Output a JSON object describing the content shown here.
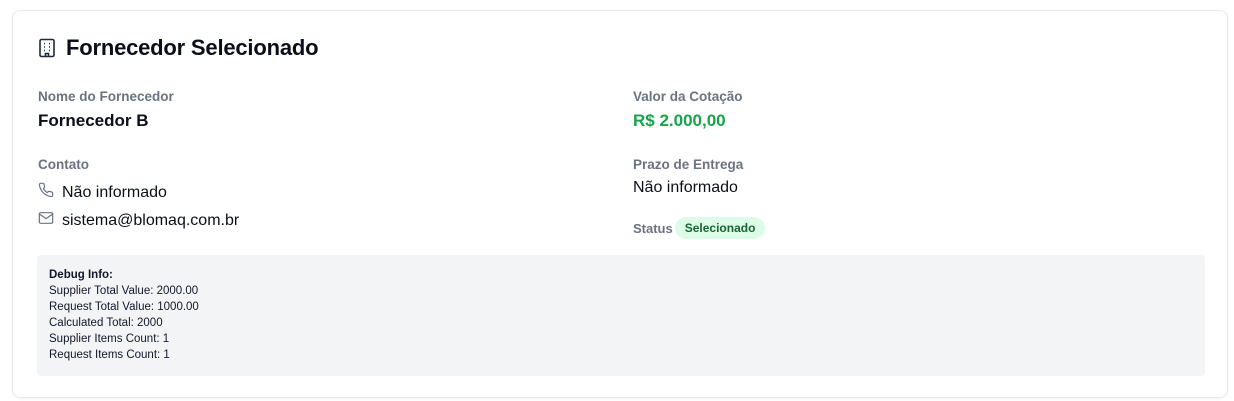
{
  "header": {
    "icon": "building-icon",
    "title": "Fornecedor Selecionado"
  },
  "supplier": {
    "name_label": "Nome do Fornecedor",
    "name": "Fornecedor B",
    "contact_label": "Contato",
    "phone_icon": "phone-icon",
    "phone": "Não informado",
    "email_icon": "mail-icon",
    "email": "sistema@blomaq.com.br"
  },
  "quote": {
    "value_label": "Valor da Cotação",
    "value": "R$ 2.000,00",
    "value_color": "#16a34a",
    "delivery_label": "Prazo de Entrega",
    "delivery": "Não informado",
    "status_label": "Status",
    "status": "Selecionado",
    "status_bg": "#dcfce7",
    "status_color": "#166534"
  },
  "debug": {
    "title": "Debug Info:",
    "lines": [
      "Supplier Total Value: 2000.00",
      "Request Total Value: 1000.00",
      "Calculated Total: 2000",
      "Supplier Items Count: 1",
      "Request Items Count: 1"
    ]
  }
}
